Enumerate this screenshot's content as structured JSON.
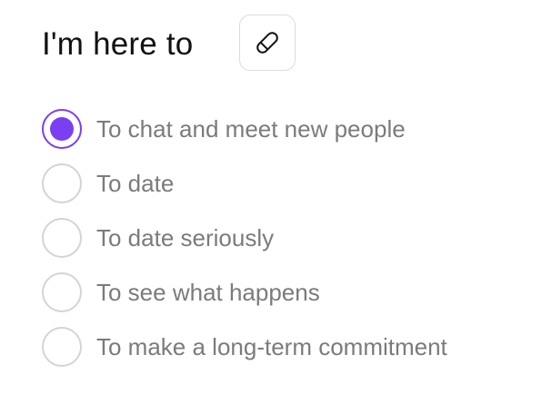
{
  "header": {
    "title": "I'm here to",
    "edit_icon": "pencil-edit-icon"
  },
  "accent_color": "#7a3ff1",
  "options": [
    {
      "label": "To chat and meet new people",
      "selected": true
    },
    {
      "label": "To date",
      "selected": false
    },
    {
      "label": "To date seriously",
      "selected": false
    },
    {
      "label": "To see what happens",
      "selected": false
    },
    {
      "label": "To make a long-term commitment",
      "selected": false
    }
  ]
}
